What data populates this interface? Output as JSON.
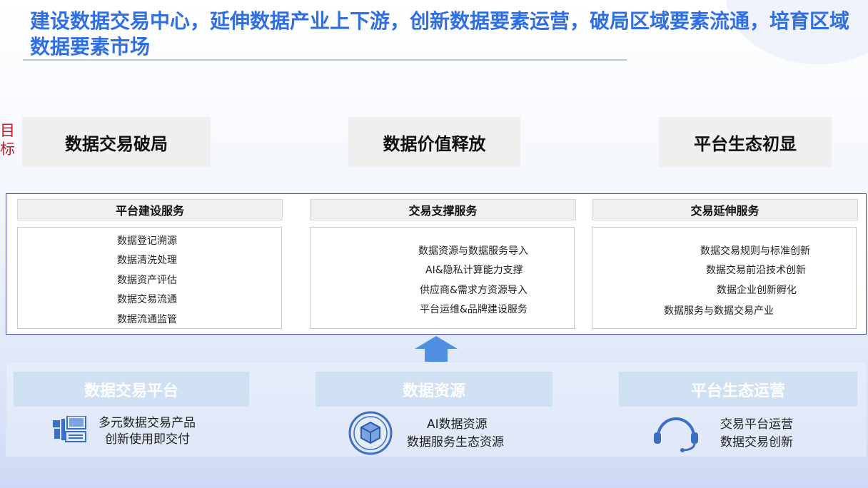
{
  "title": "建设数据交易中心，延伸数据产业上下游，创新数据要素运营，破局区域要素流通，培育区域数据要素市场",
  "goal_label": "目标",
  "goals": [
    "数据交易破局",
    "数据价值释放",
    "平台生态初显"
  ],
  "services": [
    {
      "header": "平台建设服务",
      "items": [
        "数据登记溯源",
        "数据清洗处理",
        "数据资产评估",
        "数据交易流通",
        "数据流通监管"
      ]
    },
    {
      "header": "交易支撑服务",
      "items": [
        "数据资源与数据服务导入",
        "AI&隐私计算能力支撑",
        "供应商&需求方资源导入",
        "平台运维&品牌建设服务"
      ]
    },
    {
      "header": "交易延伸服务",
      "items": [
        "数据交易规则与标准创新",
        "数据交易前沿技术创新",
        "数据企业创新孵化",
        "数据服务与数据交易产业"
      ]
    }
  ],
  "foundations": [
    {
      "header": "数据交易平台",
      "lines": [
        "多元数据交易产品",
        "创新使用即交付"
      ],
      "icon": "workstation-icon"
    },
    {
      "header": "数据资源",
      "lines": [
        "AI数据资源",
        "数据服务生态资源"
      ],
      "icon": "cube-icon"
    },
    {
      "header": "平台生态运营",
      "lines": [
        "交易平台运营",
        "数据交易创新"
      ],
      "icon": "headset-icon"
    }
  ],
  "colors": {
    "title": "#2f6fe3",
    "goal_label": "#c0202a",
    "arrow": "#4f8fe0",
    "foundation_header_bg": "#cfe0f3",
    "icon": "#3a6fc4"
  }
}
